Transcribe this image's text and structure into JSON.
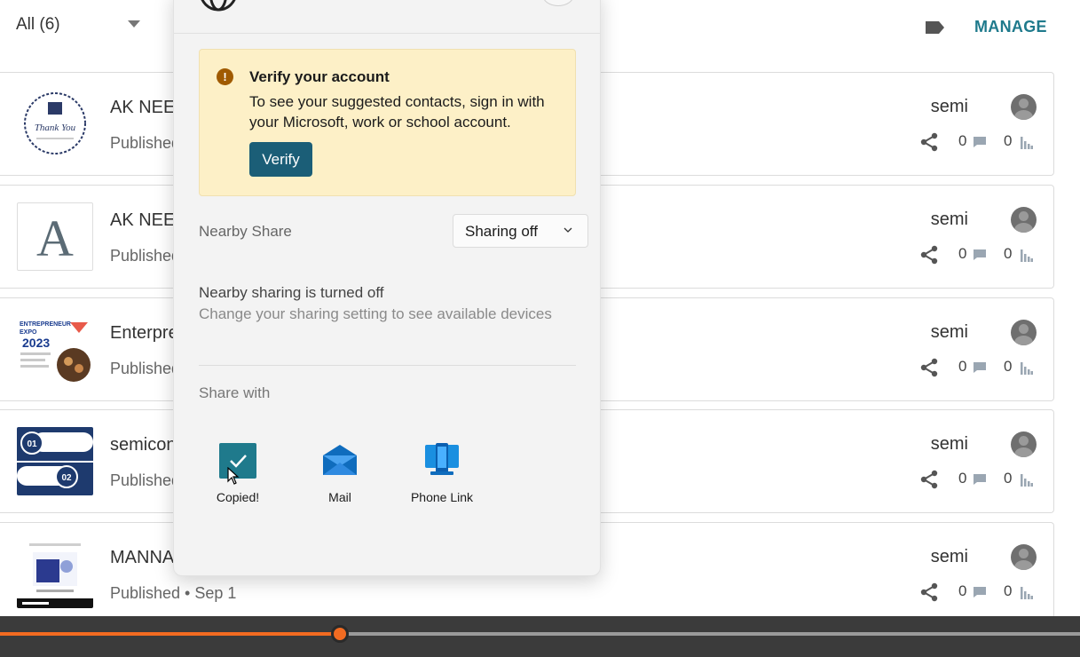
{
  "toolbar": {
    "filter_label": "All (6)",
    "manage_label": "MANAGE"
  },
  "items": [
    {
      "title": "AK NEET",
      "status": "Published",
      "author": "semi",
      "comments": "0",
      "views": "0",
      "thumb": "thank-you-card"
    },
    {
      "title": "AK NEET",
      "status": "Published",
      "author": "semi",
      "comments": "0",
      "views": "0",
      "thumb": "letter-a"
    },
    {
      "title": "Enterpre",
      "status": "Published",
      "author": "semi",
      "comments": "0",
      "views": "0",
      "thumb": "entrepreneur-expo"
    },
    {
      "title": "semicon",
      "status": "Published",
      "author": "semi",
      "comments": "0",
      "views": "0",
      "thumb": "semiconductor-steps"
    },
    {
      "title": "MANNA",
      "status": "Published • Sep 1",
      "author": "semi",
      "comments": "0",
      "views": "0",
      "thumb": "manna-flyer"
    }
  ],
  "thumb_text": {
    "thanks": "Thank You",
    "letter": "A",
    "expo_line1": "ENTREPRENEUR",
    "expo_line2": "EXPO",
    "expo_year": "2023",
    "step1": "01",
    "step2": "02"
  },
  "share_panel": {
    "verify_title": "Verify your account",
    "verify_body": "To see your suggested contacts, sign in with your Microsoft, work or school account.",
    "verify_button": "Verify",
    "nearby_label": "Nearby Share",
    "nearby_value": "Sharing off",
    "off_title": "Nearby sharing is turned off",
    "off_subtitle": "Change your sharing setting to see available devices",
    "share_with_label": "Share with",
    "apps": [
      {
        "label": "Copied!",
        "icon": "check-icon"
      },
      {
        "label": "Mail",
        "icon": "mail-icon"
      },
      {
        "label": "Phone Link",
        "icon": "phone-link-icon"
      }
    ]
  },
  "media": {
    "progress": 0.315
  },
  "colors": {
    "accent": "#1f7a8c",
    "verify_button": "#1b5e77",
    "warning_bg": "#fdf0c7",
    "scrubber": "#f26b21"
  }
}
